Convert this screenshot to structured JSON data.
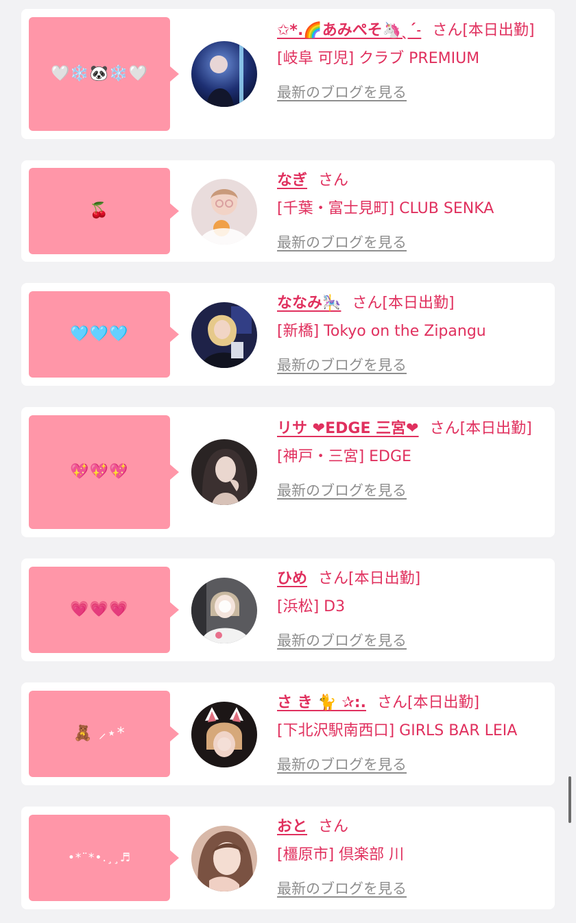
{
  "colors": {
    "page_background": "#f2f2f4",
    "card_background": "#ffffff",
    "bubble": "#ff96a8",
    "accent_text": "#e0305e",
    "link_gray": "#8e8e8e"
  },
  "posts": [
    {
      "message": "🤍❄️🐼❄️🤍",
      "name": "✩*.🌈あみぺそ🦄ˎˊ˗",
      "suffix": "さん[本日出勤]",
      "shop": "[岐阜 可児] クラブ PREMIUM",
      "blog_link": "最新のブログを見る",
      "avatar_icon": "avatar-photo"
    },
    {
      "message": "🍒",
      "name": "なぎ",
      "suffix": "さん",
      "shop": "[千葉・富士見町] CLUB SENKA",
      "blog_link": "最新のブログを見る",
      "avatar_icon": "avatar-photo"
    },
    {
      "message": "🩵🩵🩵",
      "name": "ななみ🎠",
      "suffix": "さん[本日出勤]",
      "shop": "[新橋] Tokyo on the Zipangu",
      "blog_link": "最新のブログを見る",
      "avatar_icon": "avatar-photo"
    },
    {
      "message": "💖💖💖",
      "name": "リサ ❤EDGE 三宮❤",
      "suffix": "さん[本日出勤]",
      "shop": "[神戸・三宮] EDGE",
      "blog_link": "最新のブログを見る",
      "avatar_icon": "avatar-photo"
    },
    {
      "message": "💗💗💗",
      "name": "ひめ",
      "suffix": "さん[本日出勤]",
      "shop": "[浜松] D3",
      "blog_link": "最新のブログを見る",
      "avatar_icon": "avatar-photo"
    },
    {
      "message": "🧸 ⸝⋆*",
      "name": "さ き 🐈 ✰:.",
      "suffix": "さん[本日出勤]",
      "shop": "[下北沢駅南西口] GIRLS BAR LEIA",
      "blog_link": "最新のブログを見る",
      "avatar_icon": "avatar-photo"
    },
    {
      "message": "•*¨*•.¸¸♬",
      "name": "おと",
      "suffix": "さん",
      "shop": "[橿原市] 倶楽部 川",
      "blog_link": "最新のブログを見る",
      "avatar_icon": "avatar-photo"
    }
  ]
}
